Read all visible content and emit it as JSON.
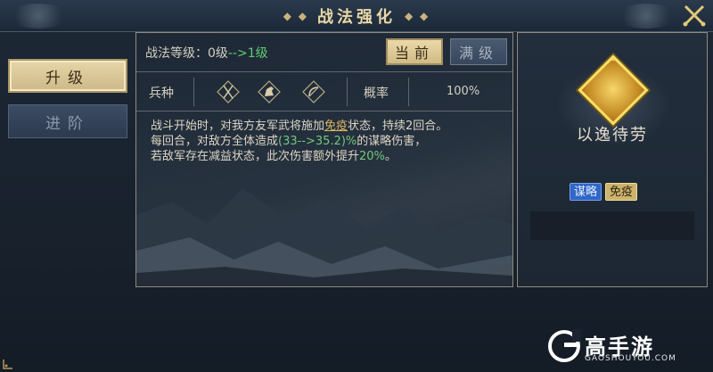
{
  "header": {
    "title": "战法强化",
    "deco_left": "◆ ◆",
    "deco_right": "◆ ◆",
    "close_icon": "close-icon"
  },
  "side_menu": {
    "upgrade_label": "升级",
    "advance_label": "进阶"
  },
  "main": {
    "level_prefix": "战法等级：0级",
    "level_arrow": "-->",
    "level_to": "1级",
    "tab_current": "当前",
    "tab_max": "满级",
    "troop_label": "兵种",
    "troop_icons": [
      "spear-infantry-icon",
      "cavalry-icon",
      "archer-icon"
    ],
    "rate_label": "概率",
    "rate_value": "100%",
    "desc": {
      "line1_a": "战斗开始时，对我方友军武将施加",
      "line1_link": "免疫",
      "line1_b": "状态，持续2回合。",
      "line2_a": "每回合，对敌方全体造成",
      "line2_val": "(33-->35.2)%",
      "line2_b": "的谋略伤害，",
      "line3_a": "若敌军存在减益状态，此次伤害额外提升",
      "line3_val": "20%",
      "line3_b": "。"
    }
  },
  "skill_card": {
    "name": "以逸待劳",
    "tag_strategy": "谋略",
    "tag_immune": "免疫"
  },
  "watermark": {
    "text": "高手游",
    "sub": "GAOSHOUYOU.COM"
  },
  "colors": {
    "gold_button": "#d9c591",
    "green_value": "#73c77d",
    "underline_gold": "#d9b760",
    "tag_blue": "#2f66c9",
    "tag_gold": "#cdb46c"
  }
}
